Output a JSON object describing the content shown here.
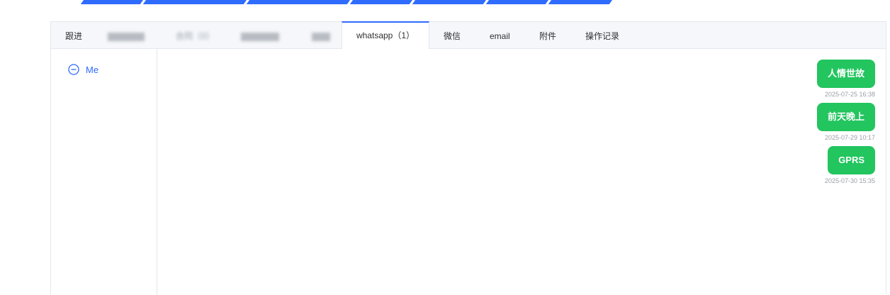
{
  "tabs": {
    "followup": "跟进",
    "whatsapp": "whatsapp（1）",
    "wechat": "微信",
    "email": "email",
    "attachment": "附件",
    "oplog": "操作记录",
    "blurred_contract": "合同（0）"
  },
  "sidebar": {
    "contact_label": "Me"
  },
  "messages": [
    {
      "text": "人情世故",
      "time": "2025-07-25 16:38"
    },
    {
      "text": "前天晚上",
      "time": "2025-07-29 10:17"
    },
    {
      "text": "GPRS",
      "time": "2025-07-30 15:35"
    }
  ],
  "colors": {
    "accent": "#2f6bff",
    "bubble": "#22c55e"
  }
}
